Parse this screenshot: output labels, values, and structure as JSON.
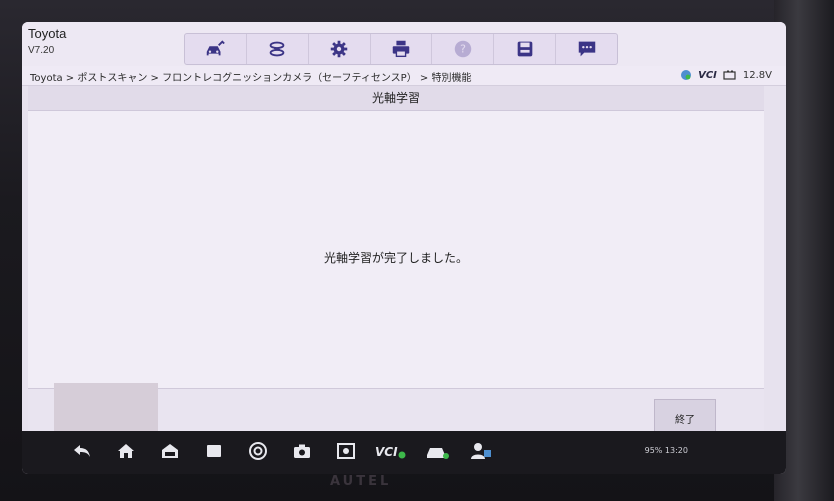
{
  "app": {
    "title": "Toyota",
    "version": "V7.20"
  },
  "toolbar": {
    "items": [
      {
        "name": "vehicle-home-icon"
      },
      {
        "name": "diagnostics-icon"
      },
      {
        "name": "settings-gear-icon"
      },
      {
        "name": "printer-icon"
      },
      {
        "name": "help-icon"
      },
      {
        "name": "save-icon"
      },
      {
        "name": "message-icon"
      }
    ]
  },
  "breadcrumb": {
    "text": "Toyota > ポストスキャン > フロントレコグニッションカメラ（セーフティセンスP） > 特別機能"
  },
  "status": {
    "vci": "VCI",
    "voltage": "12.8V"
  },
  "page": {
    "title": "光軸学習",
    "message": "光軸学習が完了しました。"
  },
  "footer": {
    "exit_label": "終了"
  },
  "system": {
    "status_text": "95% 13:20"
  },
  "brand": {
    "logo_text": "AUTEL"
  },
  "colors": {
    "accent": "#4a3e8c",
    "screen_bg": "#f1edf6"
  }
}
